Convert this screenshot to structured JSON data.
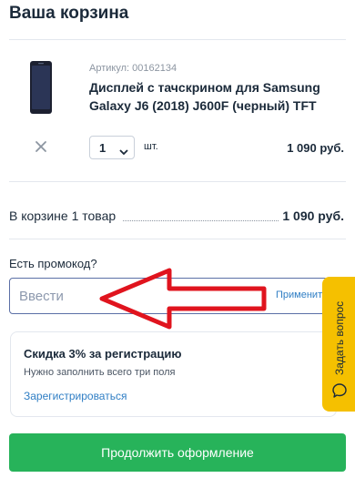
{
  "cart": {
    "title": "Ваша корзина"
  },
  "item": {
    "sku": "Артикул: 00162134",
    "name": "Дисплей с тачскрином для Samsung Galaxy J6 (2018) J600F (черный) TFT",
    "quantity": "1",
    "unit": "шт.",
    "price": "1 090 руб."
  },
  "summary": {
    "label": "В корзине 1 товар",
    "total": "1 090 руб."
  },
  "promo": {
    "label": "Есть промокод?",
    "placeholder": "Ввести",
    "apply": "Применить"
  },
  "discount": {
    "title": "Скидка 3% за регистрацию",
    "description": "Нужно заполнить всего три поля",
    "link": "Зарегистрироваться"
  },
  "checkout": {
    "button": "Продолжить оформление"
  },
  "help": {
    "tab": "Задать вопрос"
  },
  "colors": {
    "accent_green": "#27b35a",
    "link_blue": "#2f7ec4",
    "help_yellow": "#f5c000",
    "arrow_red": "#e0141e"
  },
  "icons": {
    "remove": "close-icon",
    "qty": "chevron-down-icon",
    "help": "chat-bubble-icon",
    "annotation": "arrow-left-icon"
  }
}
